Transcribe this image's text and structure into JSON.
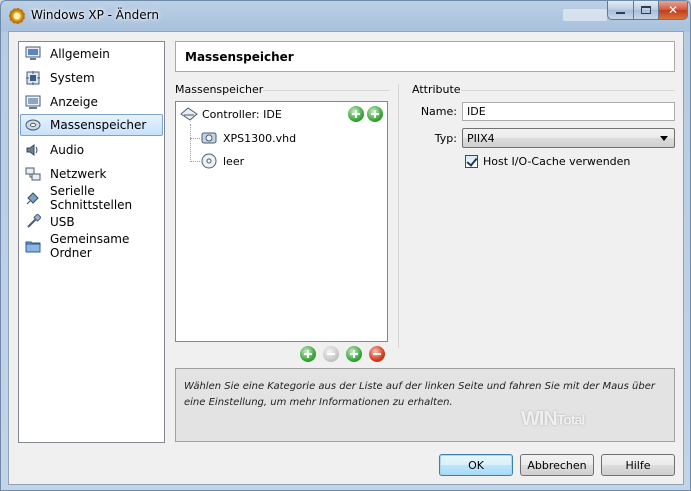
{
  "window": {
    "title": "Windows XP - Ändern"
  },
  "sidebar": {
    "items": [
      {
        "label": "Allgemein",
        "icon": "monitor-icon"
      },
      {
        "label": "System",
        "icon": "chip-icon"
      },
      {
        "label": "Anzeige",
        "icon": "display-icon"
      },
      {
        "label": "Massenspeicher",
        "icon": "disk-icon",
        "selected": true
      },
      {
        "label": "Audio",
        "icon": "speaker-icon"
      },
      {
        "label": "Netzwerk",
        "icon": "network-icon"
      },
      {
        "label": "Serielle Schnittstellen",
        "icon": "serial-port-icon"
      },
      {
        "label": "USB",
        "icon": "usb-icon"
      },
      {
        "label": "Gemeinsame Ordner",
        "icon": "folder-icon"
      }
    ]
  },
  "main": {
    "page_title": "Massenspeicher",
    "storage_group_label": "Massenspeicher",
    "attributes_group_label": "Attribute",
    "tree": {
      "controller": "Controller: IDE",
      "attachments": [
        {
          "label": "XPS1300.vhd",
          "icon": "hard-disk-icon"
        },
        {
          "label": "leer",
          "icon": "cd-icon"
        }
      ]
    },
    "attributes": {
      "name_label": "Name:",
      "name_value": "IDE",
      "type_label": "Typ:",
      "type_value": "PIIX4",
      "cache_label": "Host I/O-Cache verwenden",
      "cache_checked": true
    },
    "info_text": "Wählen Sie eine Kategorie aus der Liste auf der linken Seite und fahren Sie mit der Maus über eine Einstellung, um mehr Informationen zu erhalten."
  },
  "watermark": {
    "text_main": "WIN",
    "text_sub": "Total"
  },
  "buttons": {
    "ok": "OK",
    "cancel": "Abbrechen",
    "help": "Hilfe"
  },
  "colors": {
    "selection_border": "#7da2ce",
    "selection_fill": "#c6e1fb",
    "add_green": "#3aa63a",
    "remove_red": "#d23b1e"
  }
}
